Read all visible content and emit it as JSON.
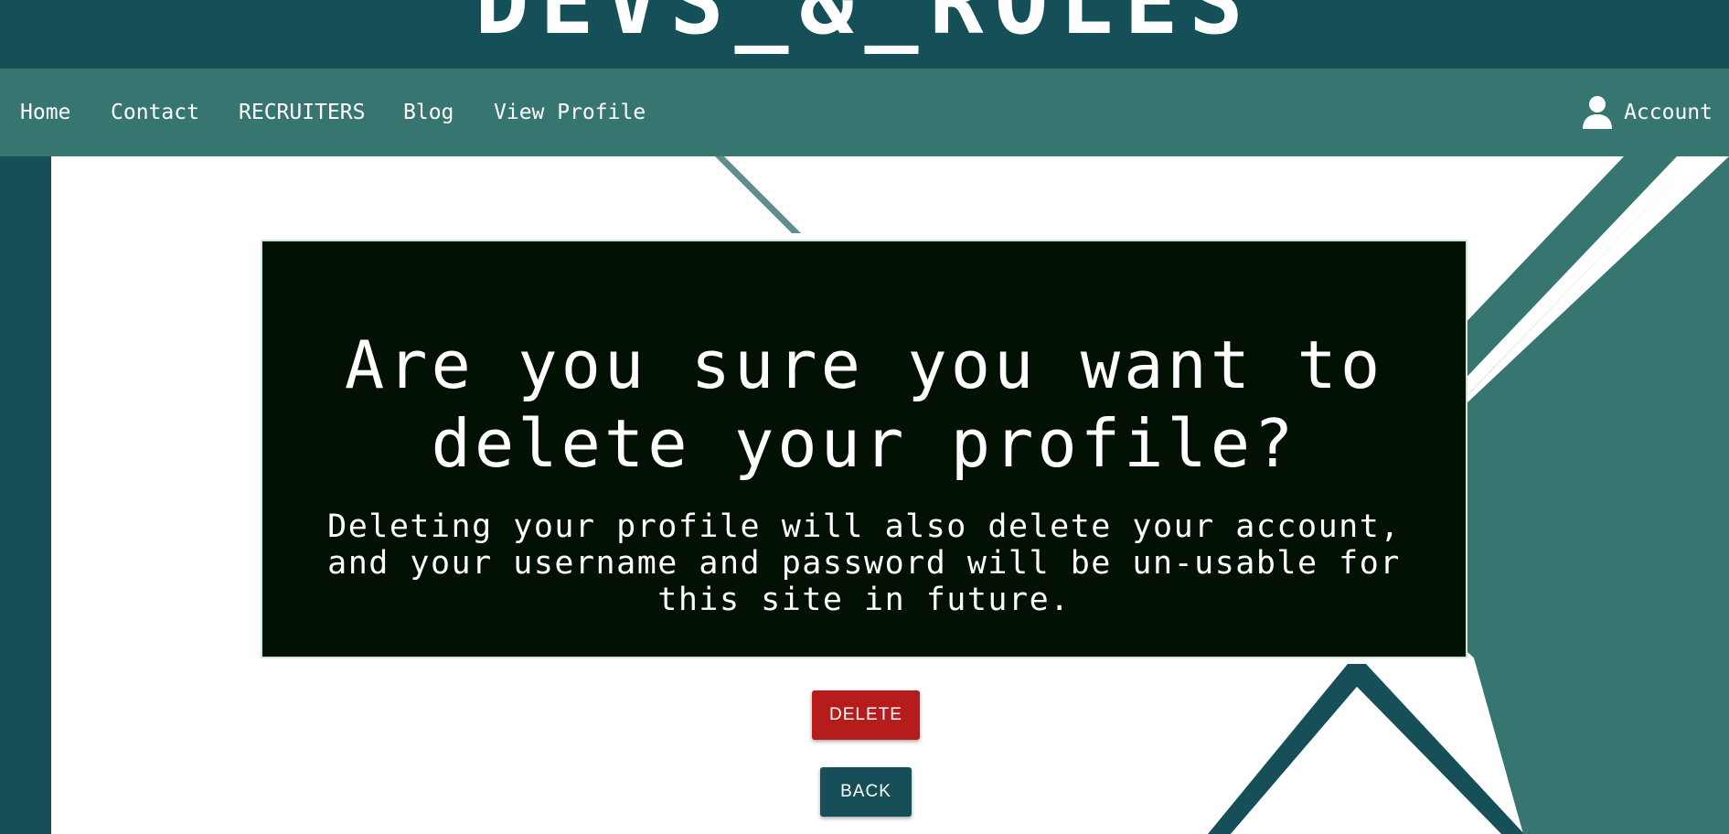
{
  "brand": {
    "title": "DEVS_&_ROLES"
  },
  "nav": {
    "items": [
      {
        "label": "Home"
      },
      {
        "label": "Contact"
      },
      {
        "label": "RECRUITERS"
      },
      {
        "label": "Blog"
      },
      {
        "label": "View Profile"
      }
    ],
    "account_label": "Account",
    "account_icon": "person-icon"
  },
  "dialog": {
    "heading": "Are you sure you want to delete your profile?",
    "message": "Deleting your profile will also delete your account, and your username and password will be un-usable for this site in future."
  },
  "actions": {
    "delete_label": "DELETE",
    "back_label": "BACK"
  },
  "colors": {
    "header_dark": "#154f58",
    "nav_teal": "#377670",
    "dialog_bg": "#031004",
    "delete_red": "#b71c1c",
    "back_teal": "#174f58"
  }
}
